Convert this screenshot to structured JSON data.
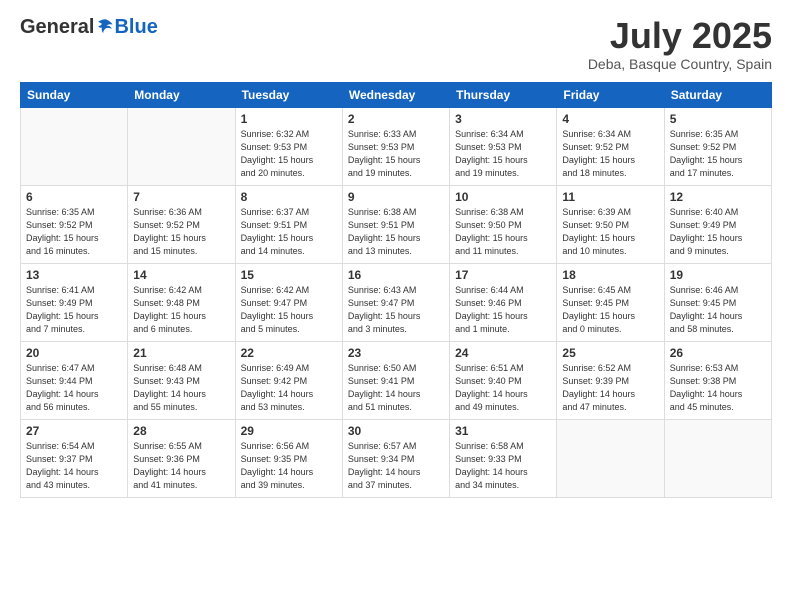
{
  "logo": {
    "general": "General",
    "blue": "Blue"
  },
  "header": {
    "month": "July 2025",
    "location": "Deba, Basque Country, Spain"
  },
  "weekdays": [
    "Sunday",
    "Monday",
    "Tuesday",
    "Wednesday",
    "Thursday",
    "Friday",
    "Saturday"
  ],
  "weeks": [
    [
      {
        "num": "",
        "info": ""
      },
      {
        "num": "",
        "info": ""
      },
      {
        "num": "1",
        "info": "Sunrise: 6:32 AM\nSunset: 9:53 PM\nDaylight: 15 hours\nand 20 minutes."
      },
      {
        "num": "2",
        "info": "Sunrise: 6:33 AM\nSunset: 9:53 PM\nDaylight: 15 hours\nand 19 minutes."
      },
      {
        "num": "3",
        "info": "Sunrise: 6:34 AM\nSunset: 9:53 PM\nDaylight: 15 hours\nand 19 minutes."
      },
      {
        "num": "4",
        "info": "Sunrise: 6:34 AM\nSunset: 9:52 PM\nDaylight: 15 hours\nand 18 minutes."
      },
      {
        "num": "5",
        "info": "Sunrise: 6:35 AM\nSunset: 9:52 PM\nDaylight: 15 hours\nand 17 minutes."
      }
    ],
    [
      {
        "num": "6",
        "info": "Sunrise: 6:35 AM\nSunset: 9:52 PM\nDaylight: 15 hours\nand 16 minutes."
      },
      {
        "num": "7",
        "info": "Sunrise: 6:36 AM\nSunset: 9:52 PM\nDaylight: 15 hours\nand 15 minutes."
      },
      {
        "num": "8",
        "info": "Sunrise: 6:37 AM\nSunset: 9:51 PM\nDaylight: 15 hours\nand 14 minutes."
      },
      {
        "num": "9",
        "info": "Sunrise: 6:38 AM\nSunset: 9:51 PM\nDaylight: 15 hours\nand 13 minutes."
      },
      {
        "num": "10",
        "info": "Sunrise: 6:38 AM\nSunset: 9:50 PM\nDaylight: 15 hours\nand 11 minutes."
      },
      {
        "num": "11",
        "info": "Sunrise: 6:39 AM\nSunset: 9:50 PM\nDaylight: 15 hours\nand 10 minutes."
      },
      {
        "num": "12",
        "info": "Sunrise: 6:40 AM\nSunset: 9:49 PM\nDaylight: 15 hours\nand 9 minutes."
      }
    ],
    [
      {
        "num": "13",
        "info": "Sunrise: 6:41 AM\nSunset: 9:49 PM\nDaylight: 15 hours\nand 7 minutes."
      },
      {
        "num": "14",
        "info": "Sunrise: 6:42 AM\nSunset: 9:48 PM\nDaylight: 15 hours\nand 6 minutes."
      },
      {
        "num": "15",
        "info": "Sunrise: 6:42 AM\nSunset: 9:47 PM\nDaylight: 15 hours\nand 5 minutes."
      },
      {
        "num": "16",
        "info": "Sunrise: 6:43 AM\nSunset: 9:47 PM\nDaylight: 15 hours\nand 3 minutes."
      },
      {
        "num": "17",
        "info": "Sunrise: 6:44 AM\nSunset: 9:46 PM\nDaylight: 15 hours\nand 1 minute."
      },
      {
        "num": "18",
        "info": "Sunrise: 6:45 AM\nSunset: 9:45 PM\nDaylight: 15 hours\nand 0 minutes."
      },
      {
        "num": "19",
        "info": "Sunrise: 6:46 AM\nSunset: 9:45 PM\nDaylight: 14 hours\nand 58 minutes."
      }
    ],
    [
      {
        "num": "20",
        "info": "Sunrise: 6:47 AM\nSunset: 9:44 PM\nDaylight: 14 hours\nand 56 minutes."
      },
      {
        "num": "21",
        "info": "Sunrise: 6:48 AM\nSunset: 9:43 PM\nDaylight: 14 hours\nand 55 minutes."
      },
      {
        "num": "22",
        "info": "Sunrise: 6:49 AM\nSunset: 9:42 PM\nDaylight: 14 hours\nand 53 minutes."
      },
      {
        "num": "23",
        "info": "Sunrise: 6:50 AM\nSunset: 9:41 PM\nDaylight: 14 hours\nand 51 minutes."
      },
      {
        "num": "24",
        "info": "Sunrise: 6:51 AM\nSunset: 9:40 PM\nDaylight: 14 hours\nand 49 minutes."
      },
      {
        "num": "25",
        "info": "Sunrise: 6:52 AM\nSunset: 9:39 PM\nDaylight: 14 hours\nand 47 minutes."
      },
      {
        "num": "26",
        "info": "Sunrise: 6:53 AM\nSunset: 9:38 PM\nDaylight: 14 hours\nand 45 minutes."
      }
    ],
    [
      {
        "num": "27",
        "info": "Sunrise: 6:54 AM\nSunset: 9:37 PM\nDaylight: 14 hours\nand 43 minutes."
      },
      {
        "num": "28",
        "info": "Sunrise: 6:55 AM\nSunset: 9:36 PM\nDaylight: 14 hours\nand 41 minutes."
      },
      {
        "num": "29",
        "info": "Sunrise: 6:56 AM\nSunset: 9:35 PM\nDaylight: 14 hours\nand 39 minutes."
      },
      {
        "num": "30",
        "info": "Sunrise: 6:57 AM\nSunset: 9:34 PM\nDaylight: 14 hours\nand 37 minutes."
      },
      {
        "num": "31",
        "info": "Sunrise: 6:58 AM\nSunset: 9:33 PM\nDaylight: 14 hours\nand 34 minutes."
      },
      {
        "num": "",
        "info": ""
      },
      {
        "num": "",
        "info": ""
      }
    ]
  ]
}
